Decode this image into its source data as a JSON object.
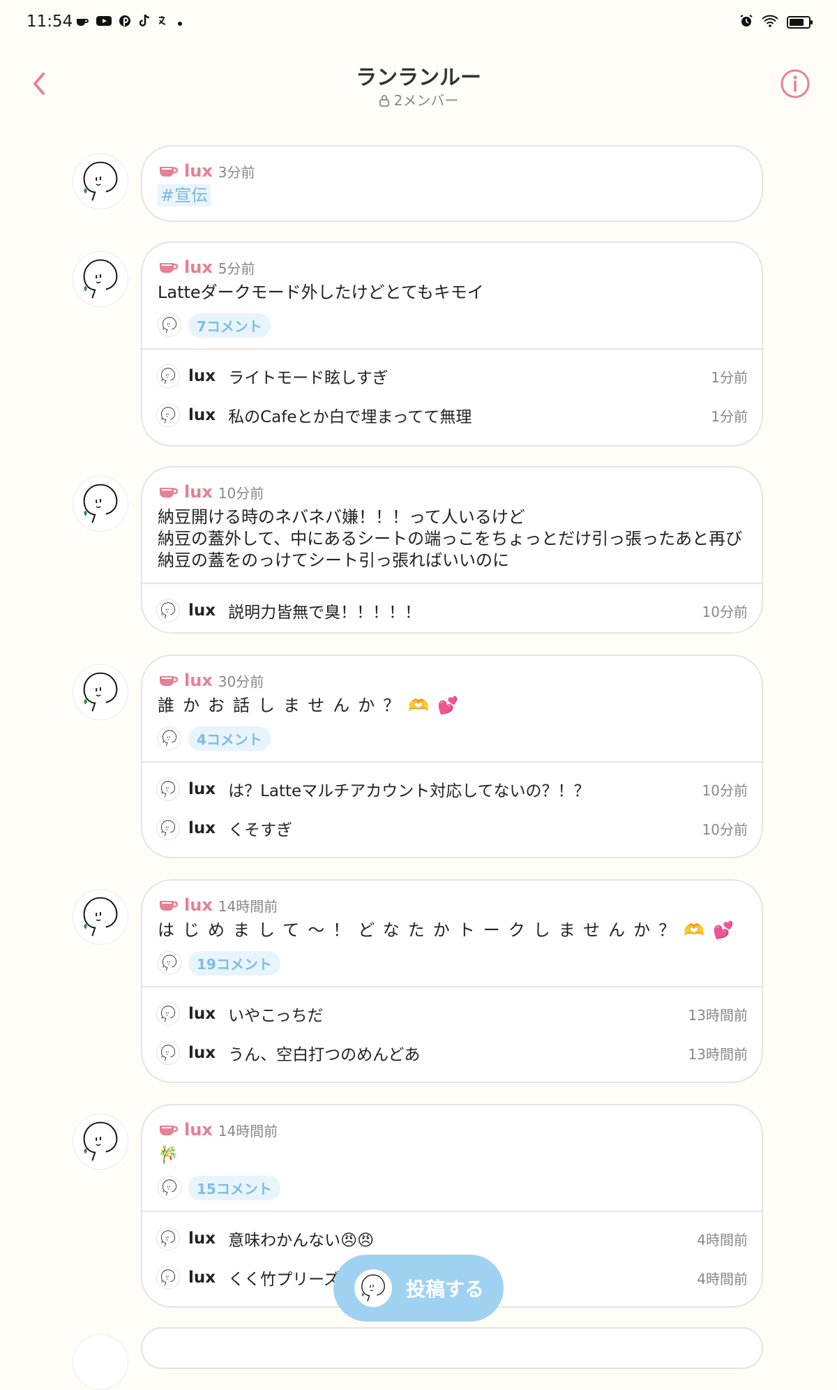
{
  "status_bar": {
    "time": "11:54",
    "left_icons": [
      "coffee-icon",
      "youtube-icon",
      "pinterest-icon",
      "tiktok-icon",
      "translate-icon",
      "dot-icon"
    ],
    "right_icons": [
      "alarm-icon",
      "wifi-icon",
      "battery-icon"
    ]
  },
  "header": {
    "title": "ランランルー",
    "subtitle": "2メンバー",
    "back_icon": "chevron-left-icon",
    "info_icon": "info-icon"
  },
  "colors": {
    "accent": "#e87f94",
    "comment_badge_text": "#7bbde6",
    "comment_badge_bg": "#e8f4fc",
    "fab": "#9fd2f1"
  },
  "posts": [
    {
      "author": "lux",
      "time": "3分前",
      "hashtag": "#宣伝",
      "text": "",
      "comment_count": "",
      "comments": []
    },
    {
      "author": "lux",
      "time": "5分前",
      "text": "Latteダークモード外したけどとてもキモイ",
      "comment_count": "7コメント",
      "comments": [
        {
          "author": "lux",
          "text": "ライトモード眩しすぎ",
          "time": "1分前"
        },
        {
          "author": "lux",
          "text": "私のCafeとか白で埋まってて無理",
          "time": "1分前"
        }
      ]
    },
    {
      "author": "lux",
      "time": "10分前",
      "text": "納豆開ける時のネバネバ嫌！！！って人いるけど\n納豆の蓋外して、中にあるシートの端っこをちょっとだけ引っ張ったあと再び納豆の蓋をのっけてシート引っ張ればいいのに",
      "comment_count": "",
      "comments": [
        {
          "author": "lux",
          "text": "説明力皆無で臭！！！！！",
          "time": "10分前"
        }
      ]
    },
    {
      "author": "lux",
      "time": "30分前",
      "text": "誰かお話しませんか？🫶💕",
      "comment_count": "4コメント",
      "comments": [
        {
          "author": "lux",
          "text": "は？Latteマルチアカウント対応してないの？！？",
          "time": "10分前"
        },
        {
          "author": "lux",
          "text": "くそすぎ",
          "time": "10分前"
        }
      ]
    },
    {
      "author": "lux",
      "time": "14時間前",
      "text": "はじめまして～！どなたかトークしませんか？🫶💕",
      "comment_count": "19コメント",
      "comments": [
        {
          "author": "lux",
          "text": "いやこっちだ",
          "time": "13時間前"
        },
        {
          "author": "lux",
          "text": "うん、空白打つのめんどあ",
          "time": "13時間前"
        }
      ]
    },
    {
      "author": "lux",
      "time": "14時間前",
      "text": "🎋",
      "comment_count": "15コメント",
      "comments": [
        {
          "author": "lux",
          "text": "意味わかんない😠😠",
          "time": "4時間前"
        },
        {
          "author": "lux",
          "text": "くく竹プリーズ",
          "time": "4時間前"
        }
      ]
    }
  ],
  "fab": {
    "label": "投稿する"
  }
}
